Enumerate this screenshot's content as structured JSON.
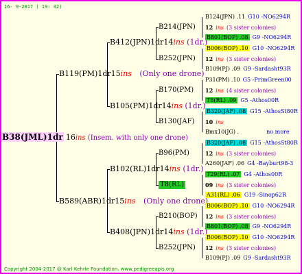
{
  "header": "16- 9-2017 ( 19: 32)",
  "root": {
    "name": "B38(JML)1dr",
    "num": "16",
    "ins": "ins",
    "note": "(Insem. with only one drone)"
  },
  "l1a": {
    "name": "B119(PM)1dr",
    "num": "15",
    "ins": "ins",
    "note": "(Only one drone)"
  },
  "l1b": {
    "name": "B589(ABR)1dr",
    "num": "15",
    "ins": "ins",
    "note": "(Only one drone)"
  },
  "l2a": {
    "name": "B412(JPN)1dr",
    "num": "14",
    "ins": "ins",
    "note": "(1dr.)"
  },
  "l2b": {
    "name": "B105(PM)1dr",
    "num": "14",
    "ins": "ins",
    "note": "(1dr.)"
  },
  "l2c": {
    "name": "B102(RL)1dr",
    "num": "14",
    "ins": "ins",
    "note": "(1dr.)"
  },
  "l2d": {
    "name": "B408(JPN)1dr",
    "num": "14",
    "ins": "ins",
    "note": "(1dr.)"
  },
  "l3": {
    "a1": "B214(JPN)",
    "a2": "B252(JPN)",
    "b1": "B170(PM)",
    "b2": "B130(JAF)",
    "c1": "B96(PM)",
    "c2": "T8(RL)",
    "d1": "B210(BOP)",
    "d2": "B252(JPN)"
  },
  "rows": [
    {
      "a": "B124(JPN) .11",
      "b": "G10 -NO6294R"
    },
    {
      "a": "12",
      "i": "ins",
      "b": "(3 sister colonies)"
    },
    {
      "a": "B801(BOP) .08",
      "b": "G9 -NO6294R"
    },
    {
      "a": "B006(BOP) .10",
      "b": "G10 -NO6294R"
    },
    {
      "a": "12",
      "i": "ins",
      "b": "(3 sister colonies)"
    },
    {
      "a": "B109(PJ) .09",
      "b": "G9 -Sardasht93R"
    },
    {
      "a": "P31(PM) .10",
      "b": "G5 -PrimGreen00"
    },
    {
      "a": "12",
      "i": "ins",
      "b": "(4 sister colonies)"
    },
    {
      "a": "T8(RL) .09",
      "b": "G5 -Athos00R"
    },
    {
      "a": "B320(JAF) .08",
      "b": "G15 -AthosSt80R"
    },
    {
      "a": "10",
      "i": "ins",
      "b": ""
    },
    {
      "a": "Bmx10(JG) .",
      "b": "no more"
    },
    {
      "a": "B320(JAF) .08",
      "b": "G15 -AthosSt80R"
    },
    {
      "a": "12",
      "i": "ins",
      "b": "(3 sister colonies)"
    },
    {
      "a": "A260(JAF) .06",
      "b": "G4 -Bayburt98-3"
    },
    {
      "a": "T29(RL) .07",
      "b": "G4 -Athos00R"
    },
    {
      "a": "09",
      "i": "ins",
      "b": "(3 sister colonies)"
    },
    {
      "a": "A31(RL) .06",
      "b": "G19 -Sinop62R"
    },
    {
      "a": "B006(BOP) .10",
      "b": "G10 -NO6294R"
    },
    {
      "a": "12",
      "i": "ins",
      "b": "(3 sister colonies)"
    },
    {
      "a": "B801(BOP) .08",
      "b": "G9 -NO6294R"
    },
    {
      "a": "B006(BOP) .10",
      "b": "G10 -NO6294R"
    },
    {
      "a": "12",
      "i": "ins",
      "b": "(3 sister colonies)"
    },
    {
      "a": "B109(PJ) .09",
      "b": "G9 -Sardasht93R"
    }
  ],
  "footer": "Copyright 2004-2017 @ Karl Kehrle Foundation.   www.pedigreeapis.org"
}
